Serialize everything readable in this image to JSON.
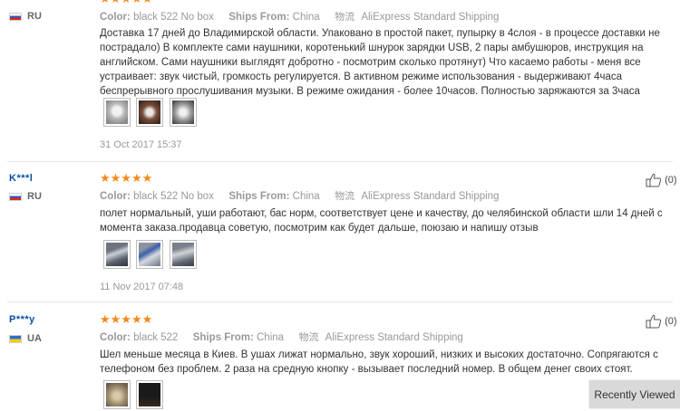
{
  "reviews": [
    {
      "name": "",
      "country": "RU",
      "stars": "★★★★★",
      "color_label": "Color:",
      "color_value": "black 522 No box",
      "ships_label": "Ships From:",
      "ships_value": "China",
      "shipping_icon": "物流",
      "shipping_method": "AliExpress Standard Shipping",
      "text": "Доставка 17 дней до Владимирской области. Упаковано в простой пакет, пупырку в 4слоя - в процессе доставки не пострадало) В комплекте сами наушники, коротенький шнурок зарядки USB, 2 пары амбушюров, инструкция на английском. Сами наушники выглядят добротно - посмотрим сколько протянут) Что касаемо работы - меня все устраивает: звук чистый, громкость регулируется. В активном режиме использования - выдерживают 4часа беспрерывного прослушивания музыки. В режиме ожидания - более 10часов. Полностью заряжаются за 3часа",
      "date": "31 Oct 2017 15:37",
      "helpful": ""
    },
    {
      "name": "K***l",
      "country": "RU",
      "stars": "★★★★★",
      "color_label": "Color:",
      "color_value": "black 522 No box",
      "ships_label": "Ships From:",
      "ships_value": "China",
      "shipping_icon": "物流",
      "shipping_method": "AliExpress Standard Shipping",
      "text": "полет нормальный, уши работают, бас норм, соответствует цене и качеству, до челябинской области шли 14 дней с момента заказа.продавца советую, посмотрим как будет дальше, поюзаю и напишу отзыв",
      "date": "11 Nov 2017 07:48",
      "helpful": "(0)"
    },
    {
      "name": "P***y",
      "country": "UA",
      "stars": "★★★★★",
      "color_label": "Color:",
      "color_value": "black 522",
      "ships_label": "Ships From:",
      "ships_value": "China",
      "shipping_icon": "物流",
      "shipping_method": "AliExpress Standard Shipping",
      "text": "Шел меньше месяца в Киев. В ушах лижат нормально, звук хороший, низких и высоких достаточно. Сопрягаются с телефоном без проблем. 2 раза на средную кнопку - вызывает последний номер. В общем денег своих стоят.",
      "date": "",
      "helpful": "(0)"
    }
  ],
  "recently_viewed": "Recently Viewed",
  "icons": {
    "helpful": "thumbs-up-icon",
    "flag_ru": "russia-flag-icon",
    "flag_ua": "ukraine-flag-icon"
  },
  "colors": {
    "stars": "#f5891a",
    "name": "#0a4fa3"
  }
}
